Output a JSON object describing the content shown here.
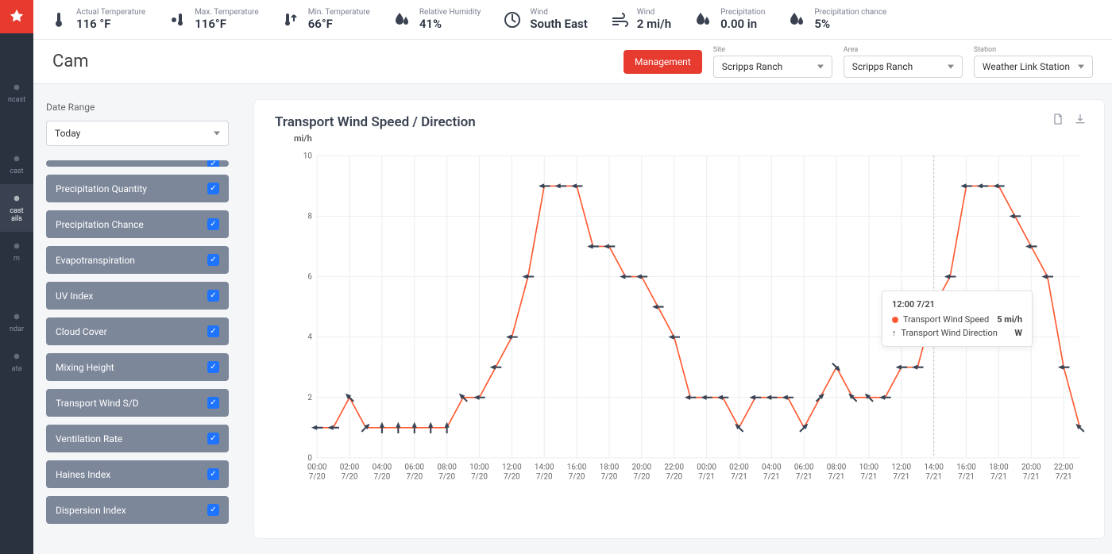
{
  "sidebar": {
    "items": [
      {
        "label": "ncast"
      },
      {
        "label": "cast"
      },
      {
        "label": "cast\nails",
        "active": true
      },
      {
        "label": "m"
      },
      {
        "label": "ndar"
      },
      {
        "label": "ata"
      }
    ]
  },
  "topbar": {
    "metrics": [
      {
        "label": "Actual Temperature",
        "value": "116 °F",
        "icon": "thermometer"
      },
      {
        "label": "Max. Temperature",
        "value": "116°F",
        "icon": "temp-high"
      },
      {
        "label": "Min. Temperature",
        "value": "66°F",
        "icon": "temp-low"
      },
      {
        "label": "Relative Humidity",
        "value": "41%",
        "icon": "humidity"
      },
      {
        "label": "Wind",
        "value": "South East",
        "icon": "wind-dir"
      },
      {
        "label": "Wind",
        "value": "2 mi/h",
        "icon": "wind"
      },
      {
        "label": "Precipitation",
        "value": "0.00 in",
        "icon": "precip"
      },
      {
        "label": "Precipitation chance",
        "value": "5%",
        "icon": "precip-chance"
      }
    ]
  },
  "header": {
    "title": "Cam",
    "button": "Management",
    "selects": [
      {
        "label": "Site",
        "value": "Scripps Ranch"
      },
      {
        "label": "Area",
        "value": "Scripps Ranch"
      },
      {
        "label": "Station",
        "value": "Weather Link Station"
      }
    ]
  },
  "leftpanel": {
    "dateRangeLabel": "Date Range",
    "dateRangeValue": "Today",
    "layers": [
      "Precipitation Quantity",
      "Precipitation Chance",
      "Evapotranspiration",
      "UV Index",
      "Cloud Cover",
      "Mixing Height",
      "Transport Wind S/D",
      "Ventilation Rate",
      "Haines Index",
      "Dispersion Index"
    ]
  },
  "chart": {
    "title": "Transport Wind Speed / Direction",
    "ylabel": "mi/h"
  },
  "tooltip": {
    "title": "12:00 7/21",
    "row1_label": "Transport Wind Speed",
    "row1_value": "5 mi/h",
    "row2_label": "Transport Wind Direction",
    "row2_value": "W"
  },
  "chart_data": {
    "type": "line",
    "title": "Transport Wind Speed / Direction",
    "ylabel": "mi/h",
    "ylim": [
      0,
      10
    ],
    "xticks": [
      "00:00\n7/20",
      "02:00\n7/20",
      "04:00\n7/20",
      "06:00\n7/20",
      "08:00\n7/20",
      "10:00\n7/20",
      "12:00\n7/20",
      "14:00\n7/20",
      "16:00\n7/20",
      "18:00\n7/20",
      "20:00\n7/20",
      "22:00\n7/20",
      "00:00\n7/21",
      "02:00\n7/21",
      "04:00\n7/21",
      "06:00\n7/21",
      "08:00\n7/21",
      "10:00\n7/21",
      "12:00\n7/21",
      "14:00\n7/21",
      "16:00\n7/21",
      "18:00\n7/21",
      "20:00\n7/21",
      "22:00\n7/21"
    ],
    "series": [
      {
        "name": "Transport Wind Speed",
        "color": "#ff5a33",
        "unit": "mi/h",
        "values": [
          1,
          1,
          2,
          1,
          1,
          1,
          1,
          1,
          1,
          2,
          2,
          3,
          4,
          6,
          9,
          9,
          9,
          7,
          7,
          6,
          6,
          5,
          4,
          2,
          2,
          2,
          1,
          2,
          2,
          2,
          1,
          2,
          3,
          2,
          2,
          2,
          3,
          3,
          5,
          6,
          9,
          9,
          9,
          8,
          7,
          6,
          3,
          1
        ]
      },
      {
        "name": "Transport Wind Direction",
        "unit": "deg",
        "values": [
          90,
          90,
          135,
          225,
          180,
          180,
          180,
          180,
          180,
          135,
          90,
          90,
          90,
          90,
          90,
          90,
          90,
          90,
          90,
          90,
          90,
          90,
          90,
          90,
          90,
          90,
          135,
          90,
          90,
          90,
          225,
          225,
          315,
          135,
          135,
          90,
          90,
          90,
          90,
          90,
          90,
          90,
          90,
          90,
          90,
          90,
          90,
          135
        ]
      }
    ],
    "cursor_index": 38
  }
}
